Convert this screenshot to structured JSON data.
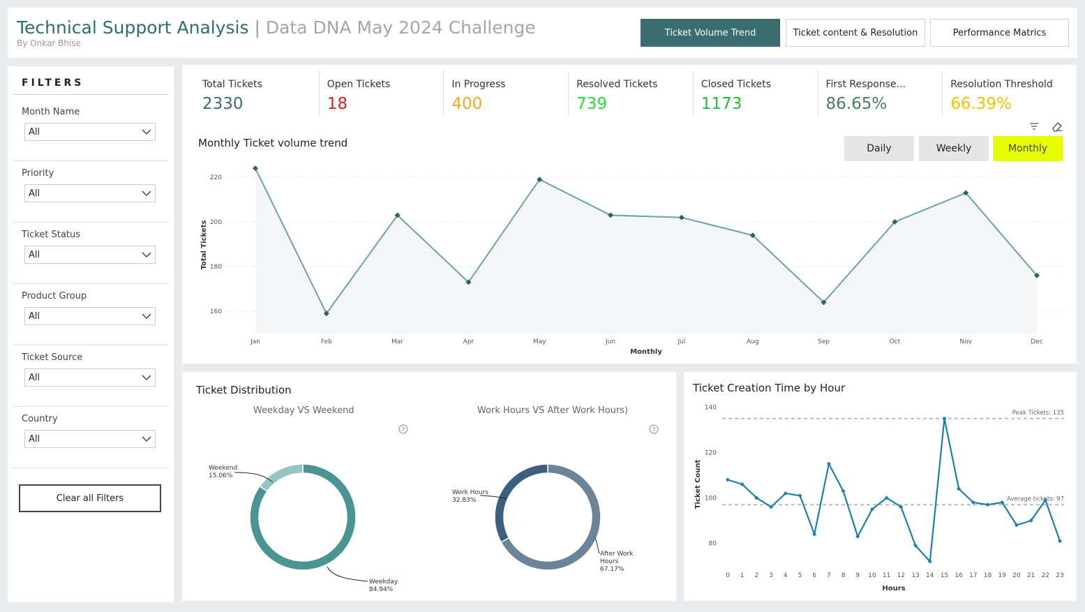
{
  "header": {
    "title": "Technical Support Analysis",
    "separator": " | ",
    "subtitle": "Data DNA May 2024 Challenge",
    "byline": "By Onkar Bhise",
    "nav": [
      {
        "label": "Ticket Volume Trend",
        "active": true
      },
      {
        "label": "Ticket content & Resolution",
        "active": false
      },
      {
        "label": "Performance Matrics",
        "active": false
      }
    ]
  },
  "filters": {
    "title": "FILTERS",
    "items": [
      {
        "label": "Month Name",
        "value": "All"
      },
      {
        "label": "Priority",
        "value": "All"
      },
      {
        "label": "Ticket Status",
        "value": "All"
      },
      {
        "label": "Product Group",
        "value": "All"
      },
      {
        "label": "Ticket Source",
        "value": "All"
      },
      {
        "label": "Country",
        "value": "All"
      }
    ],
    "clear_label": "Clear all Filters"
  },
  "kpis": [
    {
      "label": "Total Tickets",
      "value": "2330",
      "color": "#3a6e6e"
    },
    {
      "label": "Open Tickets",
      "value": "18",
      "color": "#e02020"
    },
    {
      "label": "In Progress",
      "value": "400",
      "color": "#f5a623"
    },
    {
      "label": "Resolved Tickets",
      "value": "739",
      "color": "#22e03a"
    },
    {
      "label": "Closed Tickets",
      "value": "1173",
      "color": "#1fbf3a"
    },
    {
      "label": "First Response...",
      "value": "86.65%",
      "color": "#4d7a5e"
    },
    {
      "label": "Resolution Threshold",
      "value": "66.39%",
      "color": "#f5c400"
    }
  ],
  "trend": {
    "title": "Monthly Ticket volume trend",
    "granularity": [
      {
        "label": "Daily",
        "active": false
      },
      {
        "label": "Weekly",
        "active": false
      },
      {
        "label": "Monthly",
        "active": true
      }
    ]
  },
  "distribution": {
    "title": "Ticket Distribution",
    "weekday_title": "Weekday VS Weekend",
    "workhours_title": "Work Hours VS After Work Hours)"
  },
  "hourly": {
    "title": "Ticket Creation Time by Hour"
  },
  "chart_data": [
    {
      "type": "line",
      "title": "Monthly Ticket volume trend",
      "xlabel": "Monthly",
      "ylabel": "Total Tickets",
      "categories": [
        "Jan",
        "Feb",
        "Mar",
        "Apr",
        "May",
        "Jun",
        "Jul",
        "Aug",
        "Sep",
        "Oct",
        "Nov",
        "Dec"
      ],
      "values": [
        224,
        159,
        203,
        173,
        219,
        203,
        202,
        194,
        164,
        200,
        213,
        176
      ],
      "yticks": [
        160,
        180,
        200,
        220
      ],
      "ylim": [
        150,
        225
      ],
      "area_fill": true,
      "color": "#6aa3a5",
      "marker_color": "#2e6262",
      "grid": true
    },
    {
      "type": "pie",
      "title": "Weekday VS Weekend",
      "labels": [
        "Weekday",
        "Weekend"
      ],
      "values": [
        84.94,
        15.06
      ],
      "display": [
        "84.94%",
        "15.06%"
      ],
      "colors": [
        "#4a9494",
        "#96c4c4"
      ]
    },
    {
      "type": "pie",
      "title": "Work Hours VS After Work Hours)",
      "labels": [
        "After Work Hours",
        "Work Hours"
      ],
      "values": [
        67.17,
        32.83
      ],
      "display": [
        "67.17%",
        "32.83%"
      ],
      "colors": [
        "#6a8499",
        "#3b5f7e"
      ]
    },
    {
      "type": "line",
      "title": "Ticket Creation Time by Hour",
      "xlabel": "Hours",
      "ylabel": "Ticket Count",
      "categories": [
        0,
        1,
        2,
        3,
        4,
        5,
        6,
        7,
        8,
        9,
        10,
        11,
        12,
        13,
        14,
        15,
        16,
        17,
        18,
        19,
        20,
        21,
        22,
        23
      ],
      "values": [
        108,
        106,
        100,
        96,
        102,
        101,
        84,
        115,
        103,
        83,
        95,
        100,
        96,
        79,
        72,
        135,
        104,
        98,
        97,
        98,
        88,
        90,
        99,
        81
      ],
      "yticks": [
        80,
        100,
        120,
        140
      ],
      "ylim": [
        70,
        142
      ],
      "color": "#1a7fad",
      "reference_lines": [
        {
          "label": "Peak Tickets: 135",
          "value": 135
        },
        {
          "label": "Average tickets: 97",
          "value": 97
        }
      ]
    }
  ]
}
